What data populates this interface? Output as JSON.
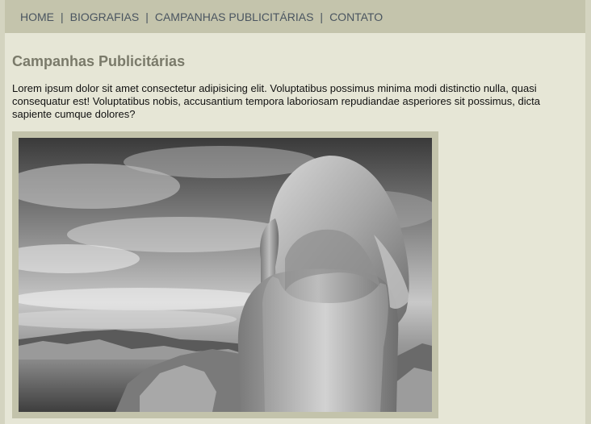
{
  "nav": {
    "items": [
      {
        "label": "HOME"
      },
      {
        "label": "BIOGRAFIAS"
      },
      {
        "label": "CAMPANHAS PUBLICITÁRIAS"
      },
      {
        "label": "CONTATO"
      }
    ],
    "separator": "|"
  },
  "main": {
    "title": "Campanhas Publicitárias",
    "intro": "Lorem ipsum dolor sit amet consectetur adipisicing elit. Voluptatibus possimus minima modi distinctio nulla, quasi consequatur est! Voluptatibus nobis, accusantium tempora laboriosam repudiandae asperiores sit possimus, dicta sapiente cumque dolores?"
  },
  "colors": {
    "page_bg": "#e6e6d6",
    "nav_bg": "#c4c4ac",
    "nav_text": "#4a5560",
    "title_text": "#7a7a6a",
    "frame_bg": "#c3c3ab"
  }
}
